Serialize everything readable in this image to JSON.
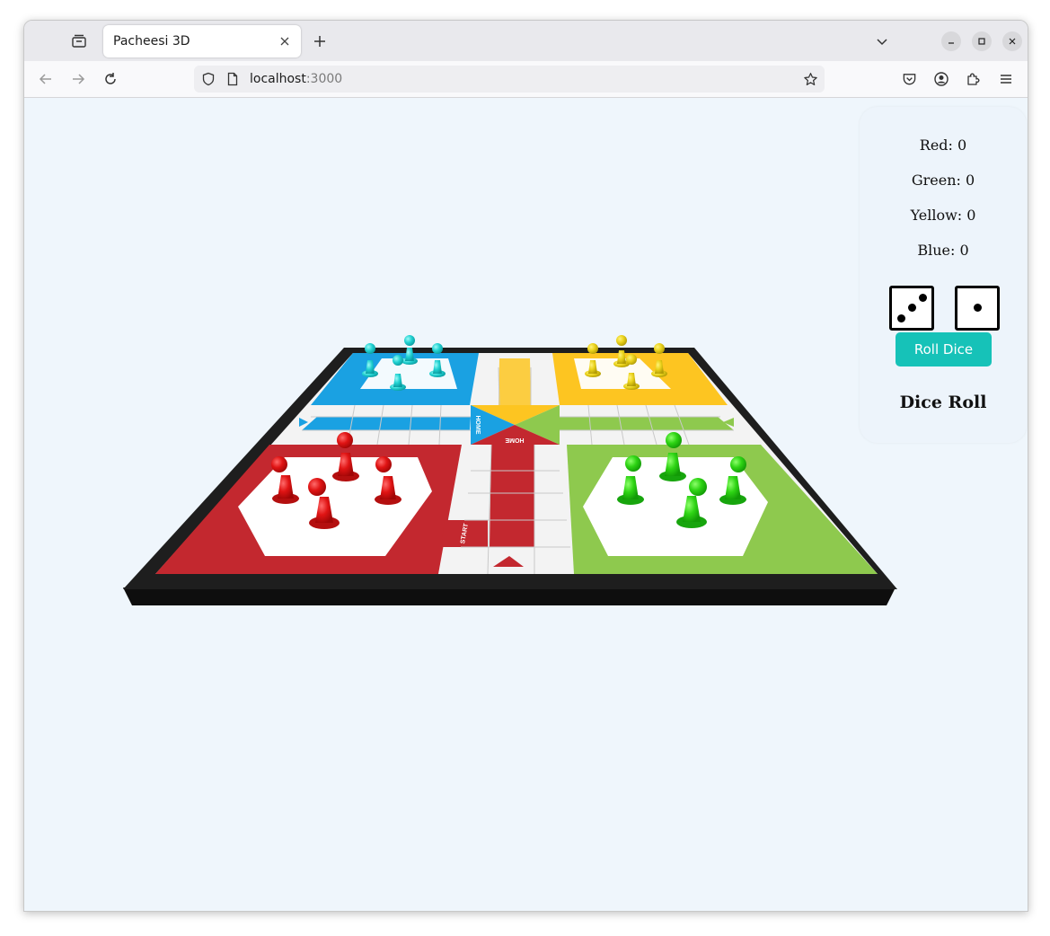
{
  "browser": {
    "tab_title": "Pacheesi 3D",
    "url_host": "localhost",
    "url_port": ":3000"
  },
  "board": {
    "labels": {
      "home": "HOME",
      "start": "START"
    },
    "colors": {
      "red": "#c3282f",
      "green": "#8ec94e",
      "yellow": "#fdc521",
      "blue": "#1aa1e2",
      "frame": "#1c1c1c"
    },
    "pieces_per_player": 4
  },
  "scores": {
    "red": "Red: 0",
    "green": "Green: 0",
    "yellow": "Yellow: 0",
    "blue": "Blue: 0"
  },
  "dice": {
    "die1_value": 3,
    "die2_value": 1,
    "roll_label": "Roll Dice",
    "title": "Dice Roll"
  },
  "icons": [
    "tab-overview-icon",
    "close-icon",
    "plus-icon",
    "chevron-down-icon",
    "minimize-icon",
    "maximize-icon",
    "back-icon",
    "forward-icon",
    "reload-icon",
    "shield-icon",
    "page-icon",
    "star-icon",
    "pocket-icon",
    "account-icon",
    "extensions-icon",
    "menu-icon"
  ]
}
